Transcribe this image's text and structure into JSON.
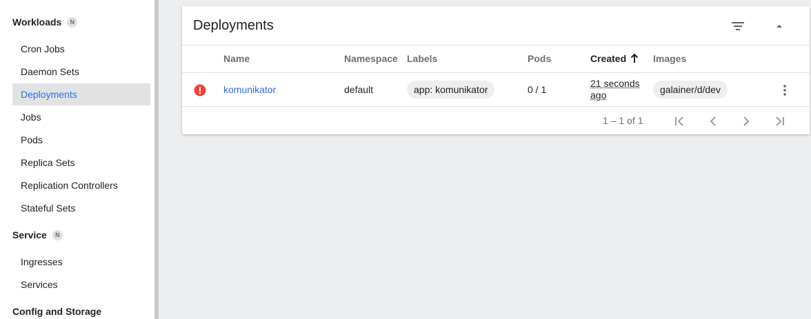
{
  "sidebar": {
    "sections": [
      {
        "title": "Workloads",
        "badge": "N"
      },
      {
        "title": "Service",
        "badge": "N"
      },
      {
        "title": "Config and Storage"
      }
    ],
    "workload_items": [
      "Cron Jobs",
      "Daemon Sets",
      "Deployments",
      "Jobs",
      "Pods",
      "Replica Sets",
      "Replication Controllers",
      "Stateful Sets"
    ],
    "service_items": [
      "Ingresses",
      "Services"
    ],
    "active_item": "Deployments"
  },
  "card": {
    "title": "Deployments",
    "columns": [
      "Name",
      "Namespace",
      "Labels",
      "Pods",
      "Created",
      "Images"
    ],
    "sort_column": "Created",
    "rows": [
      {
        "status": "error",
        "name": "komunikator",
        "namespace": "default",
        "labels": [
          "app: komunikator"
        ],
        "pods": "0 / 1",
        "created_line1": "21 seconds",
        "created_line2": "ago",
        "images": [
          "galainer/d/dev"
        ]
      }
    ]
  },
  "paginator": {
    "range": "1 – 1 of 1"
  },
  "colors": {
    "accent": "#326de6",
    "error": "#f44336",
    "active_bg": "#e1e2e4"
  }
}
